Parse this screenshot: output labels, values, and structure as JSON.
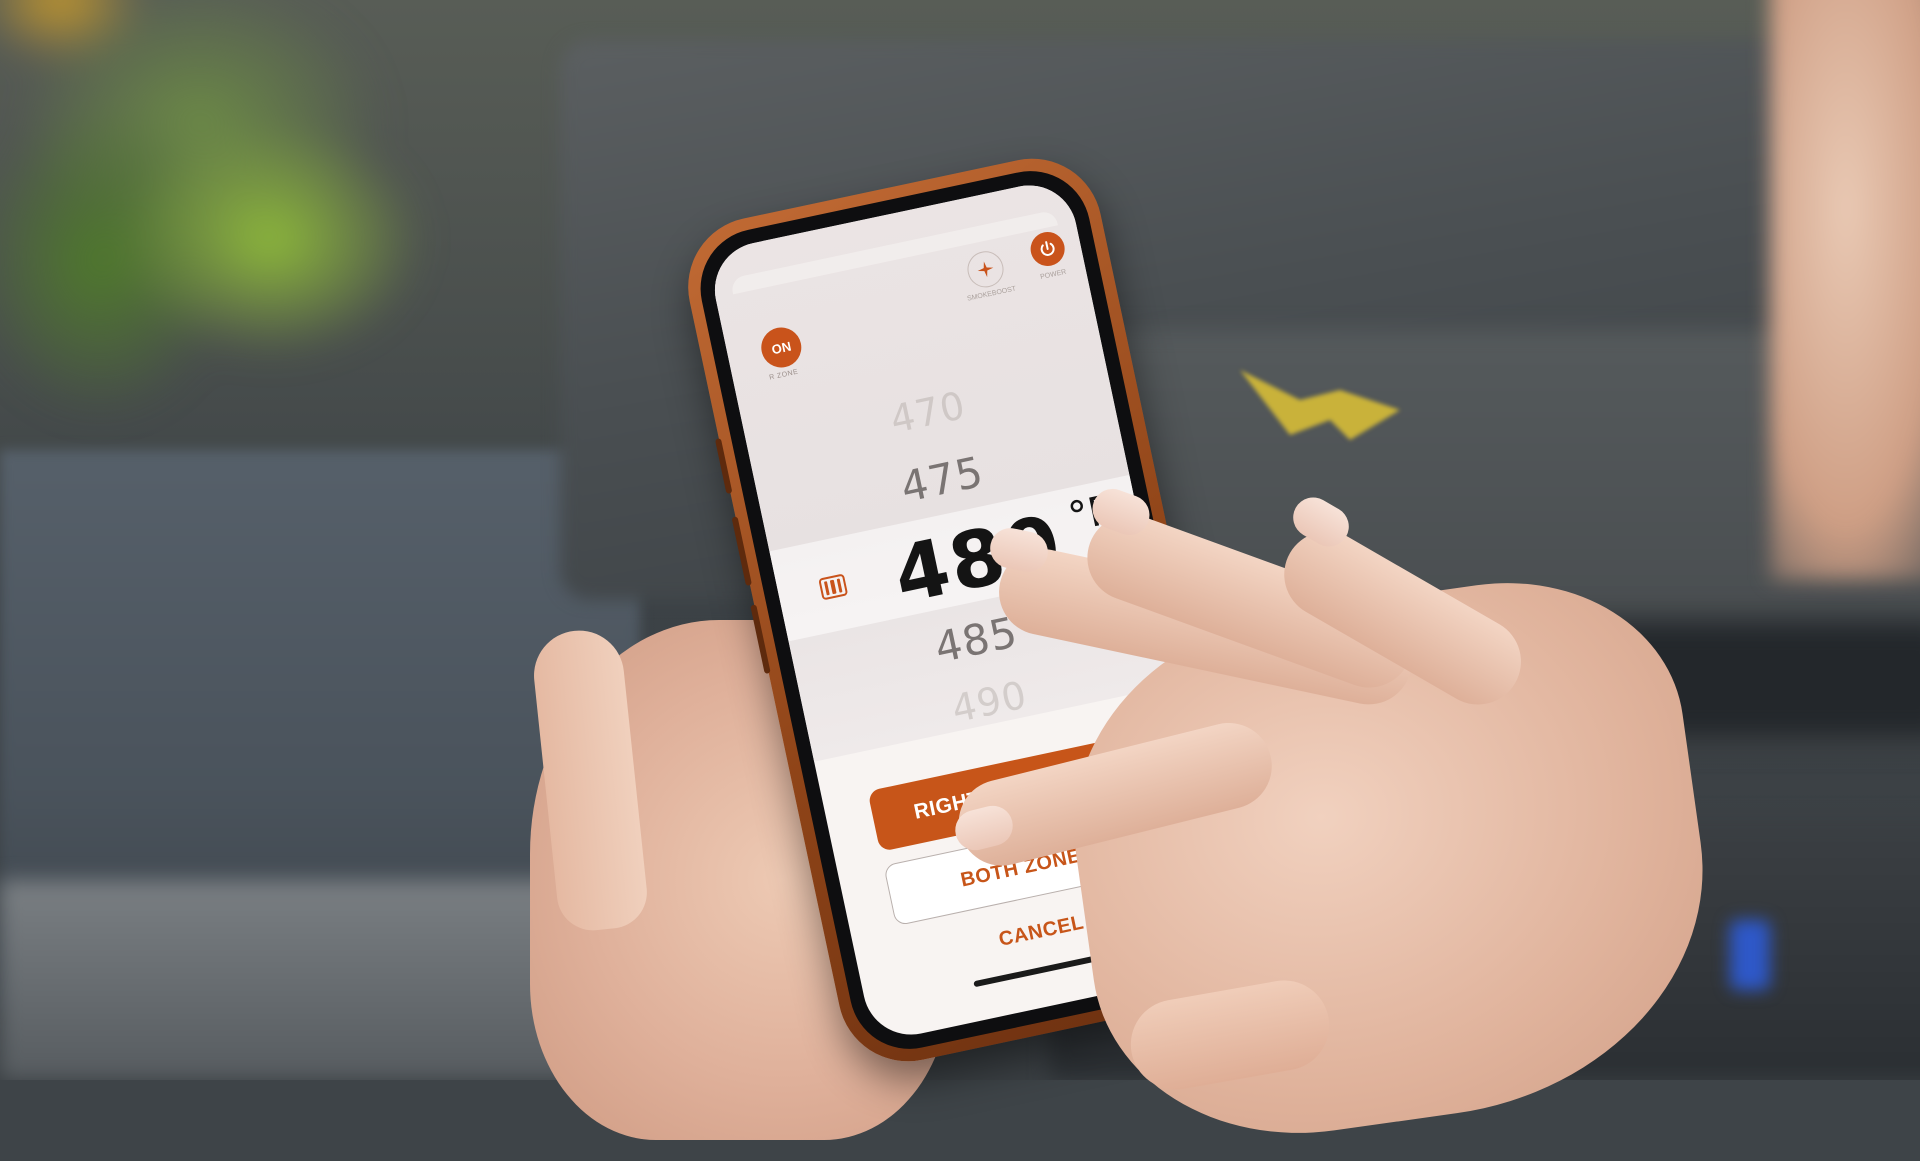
{
  "header": {
    "power_state_label": "ON",
    "zone_caption": "R ZONE",
    "sparkle_caption": "SMOKEBOOST",
    "power_caption": "POWER"
  },
  "temperature_picker": {
    "values": [
      "470",
      "475",
      "480",
      "485",
      "490"
    ],
    "selected_value": "480",
    "unit": "°F"
  },
  "actions": {
    "primary_label": "RIGHT ZONE ONLY",
    "secondary_label": "BOTH ZONES",
    "cancel_label": "CANCEL"
  },
  "icons": {
    "zone": "grill-zone-icon",
    "sparkle": "sparkle-icon",
    "power": "power-icon"
  },
  "colors": {
    "accent": "#c75519",
    "screen_bg": "#f8f4f2",
    "case": "#8f4418"
  }
}
